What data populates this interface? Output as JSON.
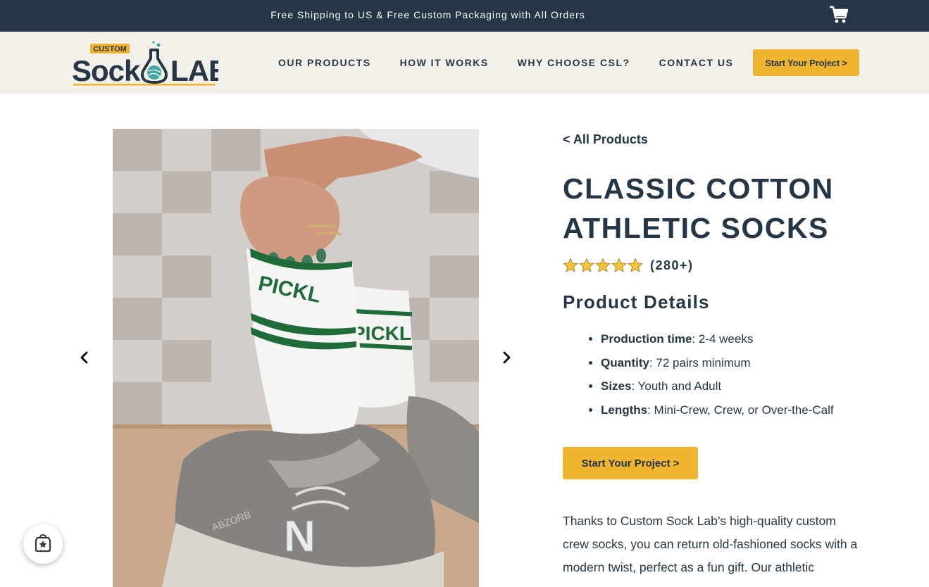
{
  "announcement": {
    "text": "Free Shipping to US & Free Custom Packaging with All Orders"
  },
  "header": {
    "logo": {
      "top_text": "CUSTOM",
      "main_left": "Sock",
      "main_right": "LAB"
    },
    "nav": [
      {
        "label": "OUR PRODUCTS"
      },
      {
        "label": "HOW IT WORKS"
      },
      {
        "label": "WHY CHOOSE CSL?"
      },
      {
        "label": "CONTACT US"
      }
    ],
    "cta_label": "Start Your Project >"
  },
  "gallery": {
    "sock_text": "PICKL",
    "shoe_letter": "N",
    "shoe_brand": "ABZORB"
  },
  "product": {
    "back_link": "< All Products",
    "title": "CLASSIC COTTON ATHLETIC SOCKS",
    "rating": {
      "stars": 5,
      "count_label": "(280+)"
    },
    "details_heading": "Product Details",
    "details": [
      {
        "label": "Production time",
        "value": ": 2-4 weeks"
      },
      {
        "label": "Quantity",
        "value": ": 72 pairs minimum"
      },
      {
        "label": "Sizes",
        "value": ": Youth and Adult"
      },
      {
        "label": "Lengths",
        "value": ": Mini-Crew, Crew, or Over-the-Calf"
      }
    ],
    "cta_label": "Start Your Project >",
    "description": "Thanks to Custom Sock Lab’s high-quality custom crew socks, you can return old-fashioned socks with a modern twist, perfect as a fun gift. Our athletic"
  },
  "colors": {
    "navy": "#253746",
    "accent": "#f1b42f",
    "header_bg": "#f3f0ea",
    "sock_stripe": "#1f6b3a"
  },
  "icons": {
    "cart": "cart-icon",
    "prev": "chevron-left-icon",
    "next": "chevron-right-icon",
    "star": "star-icon",
    "badge": "reviews-badge-icon"
  }
}
